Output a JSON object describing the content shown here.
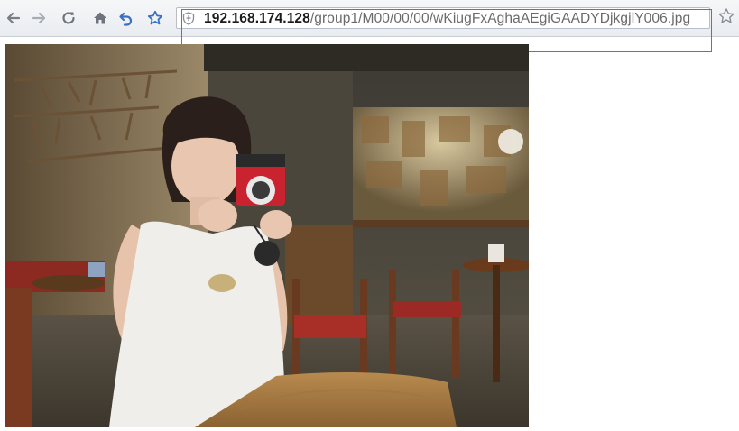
{
  "browser": {
    "url_host": "192.168.174.128",
    "url_path": "/group1/M00/00/00/wKiugFxAghaAEgiGAADYDjkgjlY006.jpg",
    "icons": [
      "back-icon",
      "forward-icon",
      "reload-icon",
      "home-icon",
      "undo-icon",
      "star-icon",
      "shield-icon",
      "bookmark-star-icon"
    ]
  },
  "content": {
    "image_description_icon": "photo"
  },
  "colors": {
    "highlight": "#d84a4a",
    "nav_blue": "#3a6fc4"
  }
}
